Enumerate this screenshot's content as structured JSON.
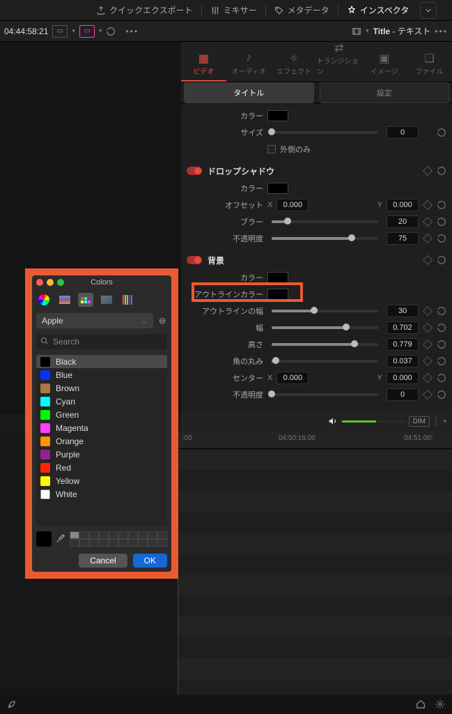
{
  "topbar": {
    "quick_export": "クイックエクスポート",
    "mixer": "ミキサー",
    "metadata": "メタデータ",
    "inspector": "インスペクタ"
  },
  "row2": {
    "timecode": "04:44:58:21",
    "title_prefix": "Title",
    "title_text": "テキスト"
  },
  "inspector_tabs": {
    "video": "ビデオ",
    "audio": "オーディオ",
    "effect": "エフェクト",
    "transition": "トランジション",
    "image": "イメージ",
    "file": "ファイル"
  },
  "subtabs": {
    "title": "タイトル",
    "settings": "設定"
  },
  "props": {
    "color_label": "カラー",
    "size_label": "サイズ",
    "size_value": "0",
    "outside_only": "外側のみ",
    "drop_shadow": "ドロップシャドウ",
    "offset_label": "オフセット",
    "x": "X",
    "y": "Y",
    "offset_x": "0.000",
    "offset_y": "0.000",
    "blur_label": "ブラー",
    "blur_value": "20",
    "opacity_label": "不透明度",
    "opacity_value": "75",
    "background": "背景",
    "outline_color_label": "アウトラインカラー",
    "outline_width_label": "アウトラインの幅",
    "outline_width_value": "30",
    "width_label": "幅",
    "width_value": "0.702",
    "height_label": "高さ",
    "height_value": "0.779",
    "corner_label": "角の丸み",
    "corner_value": "0.037",
    "center_label": "センター",
    "center_x": "0.000",
    "center_y": "0.000",
    "opacity2_label": "不透明度",
    "opacity2_value": "0"
  },
  "audio": {
    "dim": "DIM"
  },
  "ruler": {
    "t1": ":00",
    "t2": "04:50:16:00",
    "t3": "04:51:00:"
  },
  "picker": {
    "title": "Colors",
    "palette": "Apple",
    "search_placeholder": "Search",
    "colors": [
      {
        "name": "Black",
        "hex": "#000000"
      },
      {
        "name": "Blue",
        "hex": "#0433ff"
      },
      {
        "name": "Brown",
        "hex": "#aa7942"
      },
      {
        "name": "Cyan",
        "hex": "#00fdff"
      },
      {
        "name": "Green",
        "hex": "#00f900"
      },
      {
        "name": "Magenta",
        "hex": "#ff40ff"
      },
      {
        "name": "Orange",
        "hex": "#ff9300"
      },
      {
        "name": "Purple",
        "hex": "#942192"
      },
      {
        "name": "Red",
        "hex": "#ff2600"
      },
      {
        "name": "Yellow",
        "hex": "#fffb00"
      },
      {
        "name": "White",
        "hex": "#ffffff"
      }
    ],
    "cancel": "Cancel",
    "ok": "OK"
  }
}
